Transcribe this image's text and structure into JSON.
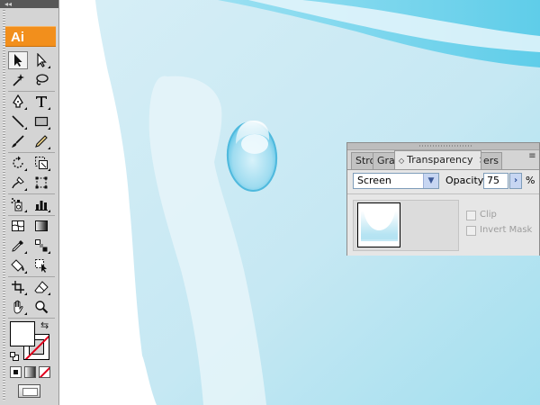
{
  "app": {
    "logo_text": "Ai",
    "collapse_glyph": "◂◂"
  },
  "toolbar": {
    "tools": [
      {
        "name": "selection-tool-icon",
        "selected": true
      },
      {
        "name": "direct-selection-tool-icon"
      },
      {
        "name": "magic-wand-tool-icon"
      },
      {
        "name": "lasso-tool-icon"
      },
      {
        "name": "pen-tool-icon"
      },
      {
        "name": "type-tool-icon"
      },
      {
        "name": "line-segment-tool-icon"
      },
      {
        "name": "rectangle-tool-icon"
      },
      {
        "name": "paintbrush-tool-icon"
      },
      {
        "name": "pencil-tool-icon"
      },
      {
        "name": "rotate-tool-icon"
      },
      {
        "name": "scale-tool-icon"
      },
      {
        "name": "warp-tool-icon"
      },
      {
        "name": "free-transform-tool-icon"
      },
      {
        "name": "symbol-sprayer-tool-icon"
      },
      {
        "name": "column-graph-tool-icon"
      },
      {
        "name": "mesh-tool-icon"
      },
      {
        "name": "gradient-tool-icon"
      },
      {
        "name": "eyedropper-tool-icon"
      },
      {
        "name": "blend-tool-icon"
      },
      {
        "name": "live-paint-bucket-tool-icon"
      },
      {
        "name": "live-paint-selection-tool-icon"
      },
      {
        "name": "slice-tool-icon"
      },
      {
        "name": "eraser-tool-icon"
      },
      {
        "name": "hand-tool-icon"
      },
      {
        "name": "zoom-tool-icon"
      }
    ],
    "fill_color": "#ffffff",
    "stroke": "none"
  },
  "transparency_panel": {
    "tabs": [
      {
        "label": "Stro",
        "active": false
      },
      {
        "label": "Gra",
        "active": false
      },
      {
        "label": "Transparency",
        "active": true,
        "arrows": "◇",
        "close": "×"
      },
      {
        "label": "ers",
        "active": false
      }
    ],
    "menu_glyph": "≡",
    "blend_mode": "Screen",
    "dropdown_glyph": "▼",
    "opacity_label": "Opacity:",
    "opacity_value": "75",
    "opacity_arrow": "›",
    "percent_sign": "%",
    "clip_label": "Clip",
    "invert_mask_label": "Invert Mask",
    "clip_checked": false,
    "invert_mask_checked": false
  },
  "colors": {
    "canvas_light": "#cde9f3",
    "canvas_mid": "#a6ddee",
    "canvas_sky": "#6ed3ef",
    "highlight": "#e9f5fa",
    "accent_orange": "#f28f1c"
  }
}
